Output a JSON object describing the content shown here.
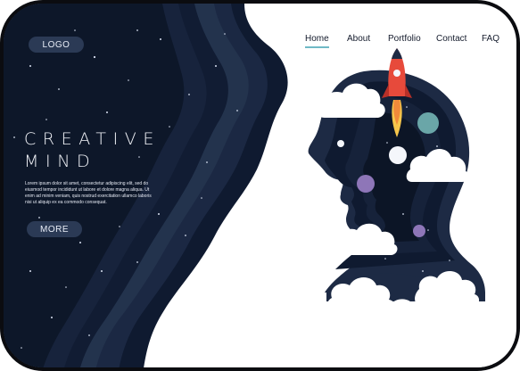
{
  "brand": {
    "logo_label": "LOGO"
  },
  "nav": {
    "items": [
      {
        "label": "Home",
        "active": true
      },
      {
        "label": "About",
        "active": false
      },
      {
        "label": "Portfolio",
        "active": false
      },
      {
        "label": "Contact",
        "active": false
      },
      {
        "label": "FAQ",
        "active": false
      }
    ]
  },
  "hero": {
    "title_line1": "CREATIVE",
    "title_line2": "MIND",
    "body": "Lorem ipsum dolor sit amet, consectetur adipiscing elit, sed do eiusmod tempor incididunt ut labore et dolore magna aliqua. Ut enim ad minim veniam, quis nostrud exercitation ullamco laboris nisi ut aliquip ex ea commodo consequat.",
    "cta_label": "MORE"
  },
  "colors": {
    "navy": "#0f1a30",
    "layer_mid": "#1d2a44",
    "layer_light": "#2c3b58",
    "accent_teal": "#6fb9c6",
    "rocket_red": "#e74a3b",
    "planet_purple": "#8e76b8",
    "planet_teal": "#6aa6a8"
  },
  "illustration": {
    "icons": [
      "rocket-icon",
      "planet-icon",
      "cloud-icon",
      "star-icon",
      "head-silhouette-icon"
    ]
  }
}
